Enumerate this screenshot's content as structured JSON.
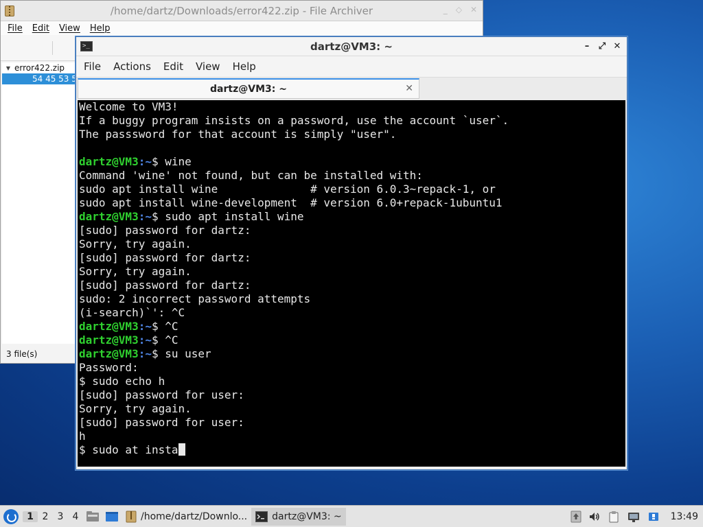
{
  "archiver": {
    "title": "/home/dartz/Downloads/error422.zip - File Archiver",
    "title_controls": [
      "_",
      "◇",
      "✕"
    ],
    "menu": [
      "File",
      "Edit",
      "View",
      "Help"
    ],
    "tree_root": "error422.zip",
    "tree_child": "54 45 53 5",
    "status": "3 file(s)"
  },
  "terminal": {
    "title": "dartz@VM3: ~",
    "controls": {
      "minimize": "–",
      "maximize": "⤢",
      "close": "✕"
    },
    "menu": [
      "File",
      "Actions",
      "Edit",
      "View",
      "Help"
    ],
    "tab_label": "dartz@VM3: ~",
    "tab_close": "✕",
    "prompt_user": "dartz@VM3",
    "prompt_path": ":~",
    "lines": [
      {
        "text": "Welcome to VM3!"
      },
      {
        "text": "If a buggy program insists on a password, use the account `user`."
      },
      {
        "text": "The passsword for that account is simply \"user\"."
      },
      {
        "text": ""
      },
      {
        "prompt": true,
        "text": "$ wine"
      },
      {
        "text": "Command 'wine' not found, but can be installed with:"
      },
      {
        "text": "sudo apt install wine              # version 6.0.3~repack-1, or"
      },
      {
        "text": "sudo apt install wine-development  # version 6.0+repack-1ubuntu1"
      },
      {
        "prompt": true,
        "text": "$ sudo apt install wine"
      },
      {
        "text": "[sudo] password for dartz:"
      },
      {
        "text": "Sorry, try again."
      },
      {
        "text": "[sudo] password for dartz:"
      },
      {
        "text": "Sorry, try again."
      },
      {
        "text": "[sudo] password for dartz:"
      },
      {
        "text": "sudo: 2 incorrect password attempts"
      },
      {
        "text": "(i-search)`': ^C"
      },
      {
        "prompt": true,
        "text": "$ ^C"
      },
      {
        "prompt": true,
        "text": "$ ^C"
      },
      {
        "prompt": true,
        "text": "$ su user"
      },
      {
        "text": "Password:"
      },
      {
        "text": "$ sudo echo h"
      },
      {
        "text": "[sudo] password for user:"
      },
      {
        "text": "Sorry, try again."
      },
      {
        "text": "[sudo] password for user:"
      },
      {
        "text": "h"
      },
      {
        "text": "$ sudo at insta",
        "cursor": true
      }
    ]
  },
  "taskbar": {
    "workspaces": [
      "1",
      "2",
      "3",
      "4"
    ],
    "active_workspace": "1",
    "tasks": [
      {
        "label": "/home/dartz/Downlo...",
        "icon": "archive-icon"
      },
      {
        "label": "dartz@VM3: ~",
        "icon": "terminal-icon",
        "active": true
      }
    ],
    "clock": "13:49"
  },
  "colors": {
    "prompt_user": "#2fd02f",
    "prompt_path": "#4f86e6",
    "selection": "#2d8fd8",
    "desktop": "#1b5fb4"
  }
}
